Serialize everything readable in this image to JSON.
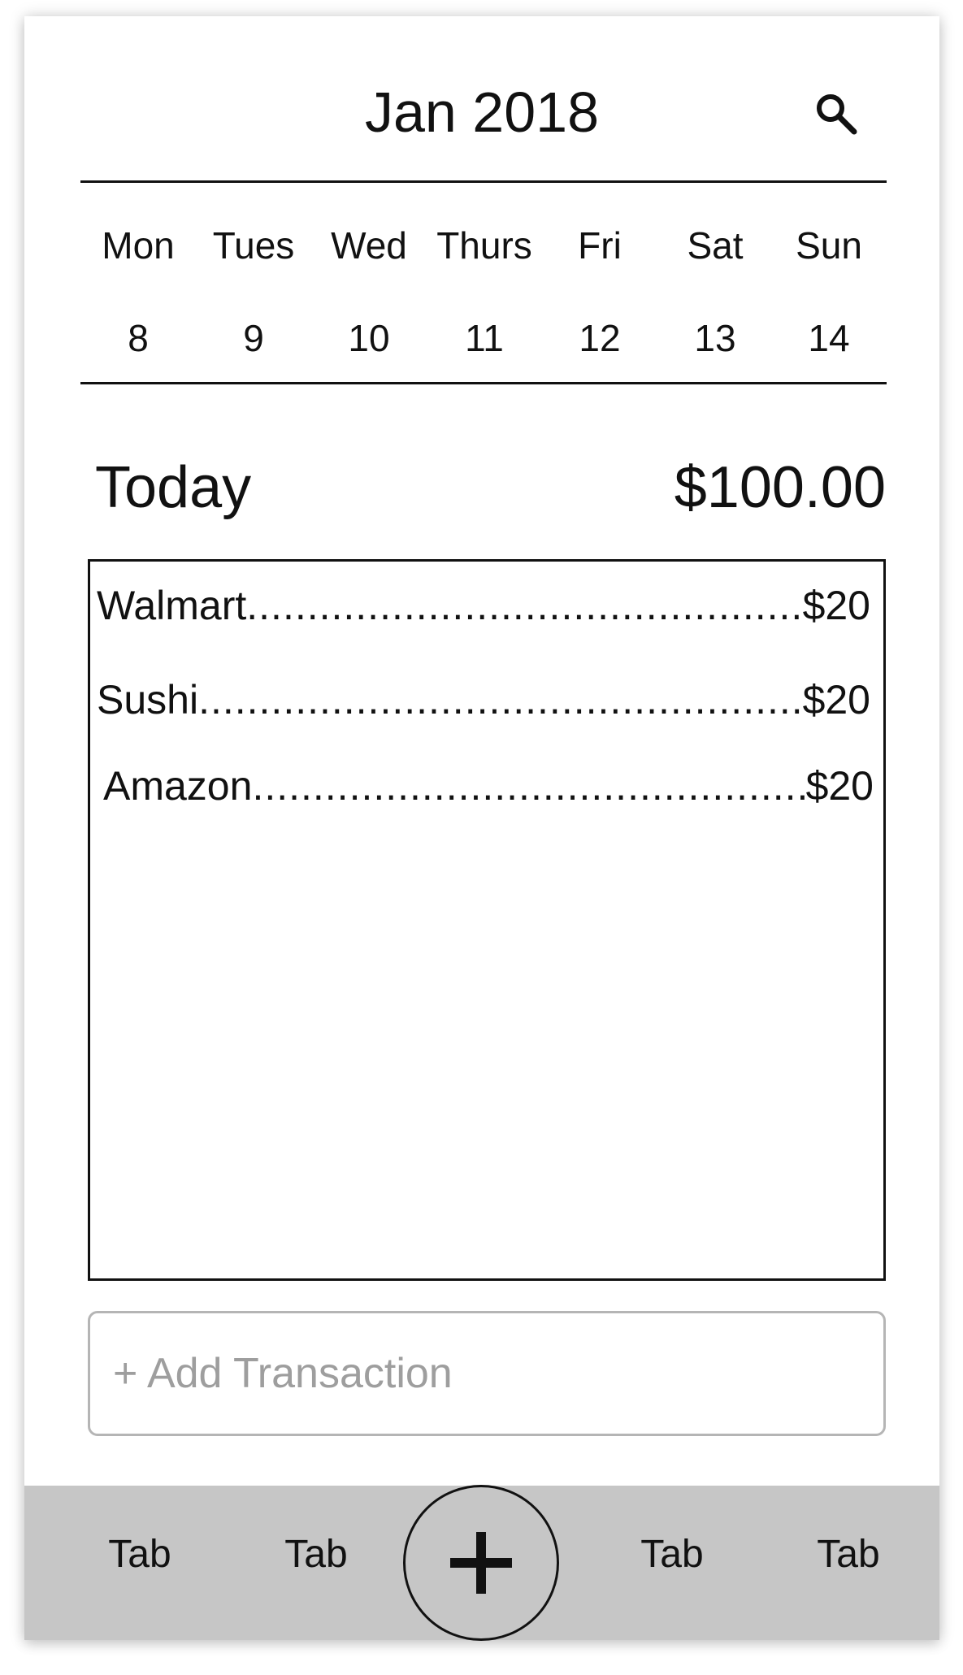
{
  "header": {
    "month_title": "Jan 2018",
    "search_icon": "search-icon"
  },
  "week": {
    "days": [
      {
        "name": "Mon",
        "num": "8"
      },
      {
        "name": "Tues",
        "num": "9"
      },
      {
        "name": "Wed",
        "num": "10"
      },
      {
        "name": "Thurs",
        "num": "11"
      },
      {
        "name": "Fri",
        "num": "12"
      },
      {
        "name": "Sat",
        "num": "13"
      },
      {
        "name": "Sun",
        "num": "14"
      }
    ]
  },
  "summary": {
    "label": "Today",
    "total": "$100.00"
  },
  "transactions": [
    {
      "name": "Walmart",
      "amount": "$20"
    },
    {
      "name": "Sushi",
      "amount": "$20"
    },
    {
      "name": "Amazon",
      "amount": "$20"
    }
  ],
  "add_transaction": {
    "placeholder": "+ Add Transaction"
  },
  "tabbar": {
    "tabs": [
      "Tab",
      "Tab",
      "Tab",
      "Tab"
    ],
    "fab_icon": "plus-icon"
  },
  "colors": {
    "tabbar_bg": "#c6c6c6",
    "placeholder_text": "#9e9e9e",
    "border": "#111111"
  }
}
